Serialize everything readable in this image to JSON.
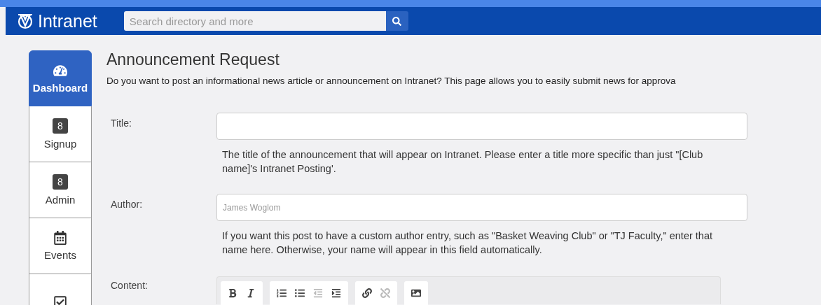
{
  "header": {
    "brand": "Intranet",
    "search": {
      "placeholder": "Search directory and more"
    }
  },
  "sidebar": {
    "items": [
      {
        "kind": "gauge",
        "label": "Dashboard",
        "selected": true
      },
      {
        "kind": "badge",
        "badge": "8",
        "label": "Signup",
        "selected": false
      },
      {
        "kind": "badge",
        "badge": "8",
        "label": "Admin",
        "selected": false
      },
      {
        "kind": "calendar",
        "label": "Events",
        "selected": false
      },
      {
        "kind": "check",
        "selected": false
      }
    ]
  },
  "page": {
    "title": "Announcement Request",
    "intro": "Do you want to post an informational news article or announcement on Intranet? This page allows you to easily submit news for approva"
  },
  "form": {
    "fields": [
      {
        "label": "Title:",
        "kind": "input",
        "help": "The title of the announcement that will appear on Intranet. Please enter a title more specific than just \"[Club name]'s Intranet Posting'."
      },
      {
        "label": "Author:",
        "kind": "input",
        "placeholder": "James Woglom",
        "help": "If you want this post to have a custom author entry, such as \"Basket Weaving Club\" or \"TJ Faculty,\" enter that name here. Otherwise, your name will appear in this field automatically."
      },
      {
        "label": "Content:",
        "kind": "editor",
        "toolbar": [
          [
            {
              "kind": "bold",
              "disabled": false
            },
            {
              "kind": "italic",
              "disabled": false
            }
          ],
          [
            {
              "kind": "ordered-list",
              "disabled": false
            },
            {
              "kind": "bullet-list",
              "disabled": false
            },
            {
              "kind": "outdent",
              "disabled": true
            },
            {
              "kind": "indent",
              "disabled": false
            }
          ],
          [
            {
              "kind": "link",
              "disabled": false
            },
            {
              "kind": "unlink",
              "disabled": true
            }
          ],
          [
            {
              "kind": "image",
              "disabled": false
            }
          ]
        ]
      }
    ]
  }
}
